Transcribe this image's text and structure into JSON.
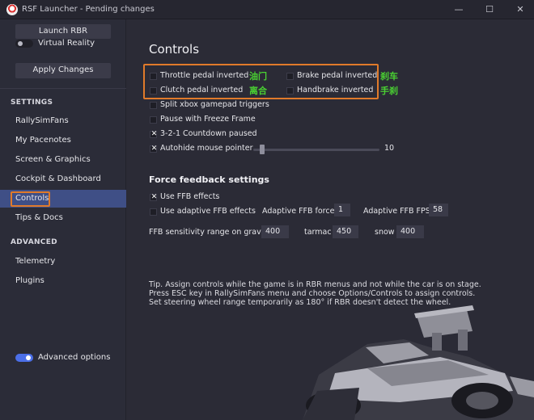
{
  "window": {
    "title": "RSF Launcher - Pending changes",
    "minimize_glyph": "—",
    "maximize_glyph": "☐",
    "close_glyph": "✕"
  },
  "sidebar": {
    "launch_label": "Launch RBR",
    "vr_label": "Virtual Reality",
    "vr_enabled": false,
    "apply_label": "Apply Changes",
    "settings_header": "SETTINGS",
    "settings_items": [
      {
        "label": "RallySimFans"
      },
      {
        "label": "My Pacenotes"
      },
      {
        "label": "Screen & Graphics"
      },
      {
        "label": "Cockpit & Dashboard"
      },
      {
        "label": "Controls",
        "active": true
      },
      {
        "label": "Tips & Docs"
      }
    ],
    "advanced_header": "ADVANCED",
    "advanced_items": [
      {
        "label": "Telemetry"
      },
      {
        "label": "Plugins"
      }
    ],
    "advanced_options_label": "Advanced options",
    "advanced_options_enabled": true
  },
  "controls": {
    "title": "Controls",
    "throttle_inverted": {
      "label": "Throttle pedal inverted",
      "checked": false,
      "annotation": "油门"
    },
    "brake_inverted": {
      "label": "Brake pedal inverted",
      "checked": false,
      "annotation": "刹车"
    },
    "clutch_inverted": {
      "label": "Clutch pedal inverted",
      "checked": false,
      "annotation": "离合"
    },
    "handbrake_inverted": {
      "label": "Handbrake inverted",
      "checked": false,
      "annotation": "手刹"
    },
    "split_xbox": {
      "label": "Split xbox gamepad triggers",
      "checked": false
    },
    "pause_freeze": {
      "label": "Pause with Freeze Frame",
      "checked": false
    },
    "countdown_paused": {
      "label": "3-2-1 Countdown paused",
      "checked": true
    },
    "autohide_pointer": {
      "label": "Autohide mouse pointer",
      "checked": true,
      "slider_value": "10",
      "slider_fraction": 0.05
    }
  },
  "ffb": {
    "title": "Force feedback settings",
    "use_ffb": {
      "label": "Use FFB effects",
      "checked": true
    },
    "adaptive": {
      "label": "Use adaptive FFB effects",
      "checked": false
    },
    "adaptive_force_label": "Adaptive FFB force",
    "adaptive_force_value": "1",
    "adaptive_fps_label": "Adaptive FFB FPS",
    "adaptive_fps_value": "58",
    "sensitivity_label": "FFB sensitivity range on gravel",
    "gravel_value": "400",
    "tarmac_label": "tarmac",
    "tarmac_value": "450",
    "snow_label": "snow",
    "snow_value": "400"
  },
  "tip": {
    "line1": "Tip. Assign controls while the game is in RBR menus and not while the car is on stage.",
    "line2": "Press ESC key in RallySimFans menu and choose Options/Controls to assign controls.",
    "line3": "Set steering wheel range temporarily as 180° if RBR doesn't detect the wheel."
  },
  "colors": {
    "background": "#2b2b36",
    "accent": "#4b6fe8",
    "active_nav": "#3f4f86",
    "highlight": "#e07a2a",
    "annotation": "#4ad232"
  },
  "icons": {
    "app": "rsf-logo-icon",
    "decoration": "rally-car-illustration"
  }
}
